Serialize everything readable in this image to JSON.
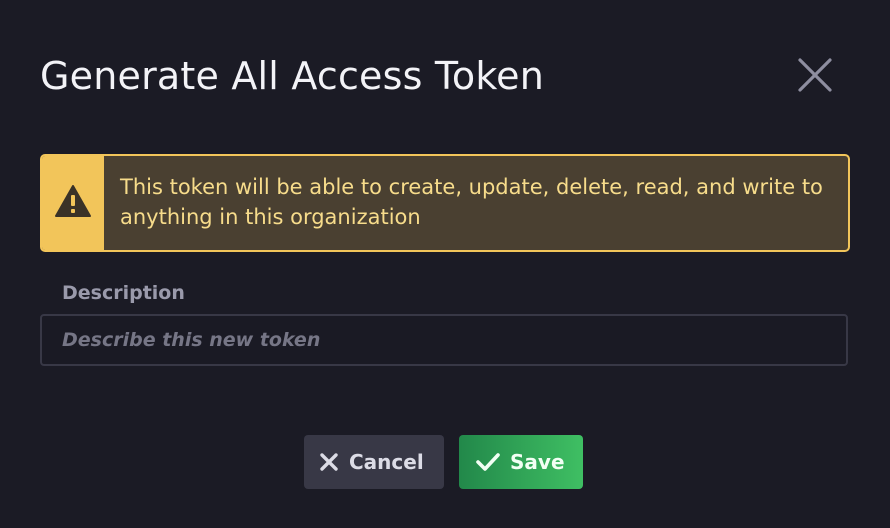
{
  "dialog": {
    "title": "Generate All Access Token",
    "close_icon": "close-icon"
  },
  "alert": {
    "icon": "warning-icon",
    "message": "This token will be able to create, update, delete, read, and write to anything in this organization",
    "colors": {
      "border": "#f2c55a",
      "background": "#4a4031",
      "text": "#f7dc8b"
    }
  },
  "description": {
    "label": "Description",
    "value": "",
    "placeholder": "Describe this new token"
  },
  "actions": {
    "cancel_label": "Cancel",
    "cancel_icon": "x-icon",
    "save_label": "Save",
    "save_icon": "checkmark-icon"
  }
}
